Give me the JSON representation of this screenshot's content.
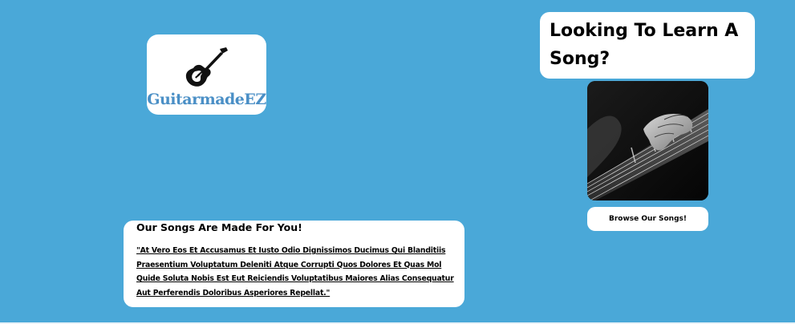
{
  "logo": {
    "text": "GuitarmadeEZ",
    "icon": "electric-guitar-icon",
    "text_color": "#4a8fc6"
  },
  "hero": {
    "heading": "Looking To Learn A Song?",
    "image": "hand-on-guitar-fretboard-photo",
    "browse_label": "Browse Our Songs!"
  },
  "songs": {
    "heading": "Our Songs Are Made For You!",
    "body": "\"At Vero Eos Et Accusamus Et Iusto Odio Dignissimos Ducimus Qui Blanditiis Praesentium Voluptatum Deleniti Atque Corrupti Quos Dolores Et Quas Mol Quide Soluta Nobis Est Eut Reiciendis Voluptatibus Maiores Alias Consequatur Aut Perferendis Doloribus Asperiores Repellat.\""
  },
  "colors": {
    "background": "#4aa8d8",
    "card": "#ffffff",
    "text": "#000000"
  }
}
